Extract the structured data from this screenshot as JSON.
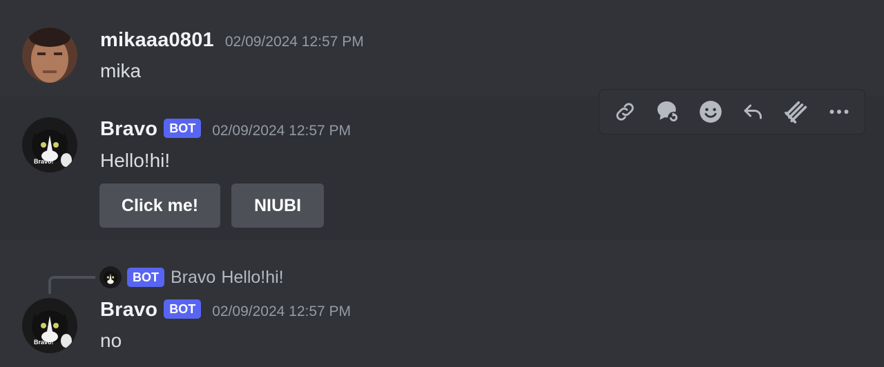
{
  "messages": [
    {
      "username": "mikaaa0801",
      "timestamp": "02/09/2024 12:57 PM",
      "content": "mika"
    },
    {
      "username": "Bravo",
      "bot_tag": "BOT",
      "timestamp": "02/09/2024 12:57 PM",
      "content": "Hello!hi!",
      "avatar_caption": "Bravo!",
      "buttons": [
        {
          "label": "Click me!"
        },
        {
          "label": "NIUBI"
        }
      ]
    },
    {
      "username": "Bravo",
      "bot_tag": "BOT",
      "timestamp": "02/09/2024 12:57 PM",
      "content": "no",
      "avatar_caption": "Bravo!",
      "reply": {
        "bot_tag": "BOT",
        "username": "Bravo",
        "content": "Hello!hi!",
        "avatar_caption": "Bravo!"
      }
    }
  ],
  "toolbar": {
    "icons": [
      "link-icon",
      "thread-icon",
      "add-reaction-icon",
      "reply-icon",
      "apps-icon",
      "more-icon"
    ]
  },
  "colors": {
    "background": "#313338",
    "bot_tag": "#5865f2",
    "button": "#4e5058",
    "timestamp": "#949ba4"
  }
}
